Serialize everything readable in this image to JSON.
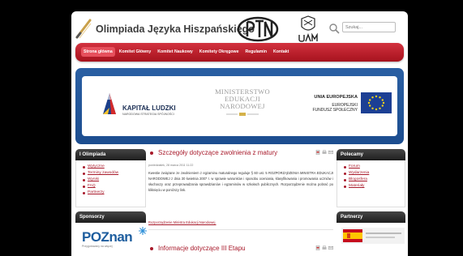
{
  "header": {
    "title": "Olimpiada Języka Hiszpańskiego",
    "search_placeholder": "Szukaj..."
  },
  "nav": {
    "items": [
      "Strona główna",
      "Komitet Główny",
      "Komitet Naukowy",
      "Komitety Okręgowe",
      "Regulamin",
      "Kontakt"
    ],
    "active_index": 0
  },
  "banner": {
    "kapital_title": "KAPITAŁ LUDZKI",
    "kapital_sub": "NARODOWA STRATEGIA SPÓJNOŚCI",
    "ministry_lines": [
      "MINISTERSTWO",
      "EDUKACJI",
      "NARODOWEJ"
    ],
    "ue_title": "UNIA EUROPEJSKA",
    "ue_sub_lines": [
      "EUROPEJSKI",
      "FUNDUSZ SPOŁECZNY"
    ]
  },
  "left_sidebar": {
    "olimpiada": {
      "title": "I Olimpiada",
      "links": [
        "Wytyczne",
        "Terminy zawodów",
        "Wyniki",
        "FAQ",
        "Partnerzy"
      ]
    },
    "sponsors": {
      "title": "Sponsorzy",
      "poznan_logo": "POZnan",
      "poznan_tag": "Przygotowany na więcej"
    }
  },
  "right_sidebar": {
    "polecamy": {
      "title": "Polecamy",
      "links": [
        "Forum",
        "Wydarzenia",
        "Blogosfera",
        "Materiały"
      ]
    },
    "partnerzy": {
      "title": "Partnerzy"
    }
  },
  "articles": [
    {
      "title": "Szczegóły dotyczące zwolnienia z matury",
      "date": "poniedziałek, 28 marca 2011 11:22",
      "body": "Kwestie związane ze zwolnieniem z egzaminu maturalnego reguluje § 60 ust. 5 ROZPORZĄDZENIA MINISTRA EDUKACJI NARODOWEJ z dnia 30 kwietnia 2007 r. w sprawie warunków i sposobu oceniania, klasyfikowania i promowania uczniów i słuchaczy oraz przeprowadzania sprawdzianów i egzaminów w szkołach publicznych. Rozporządzenie można pobrać po kliknięciu w poniższy link.",
      "link": "Rozporządzenie Ministra Edukacji Narodowej."
    },
    {
      "title": "Informacje dotyczące III Etapu"
    }
  ],
  "colors": {
    "accent": "#a8192a",
    "nav_red": "#c0222e",
    "banner_blue": "#2a5fa3",
    "box_header": "#2e2e2e"
  }
}
